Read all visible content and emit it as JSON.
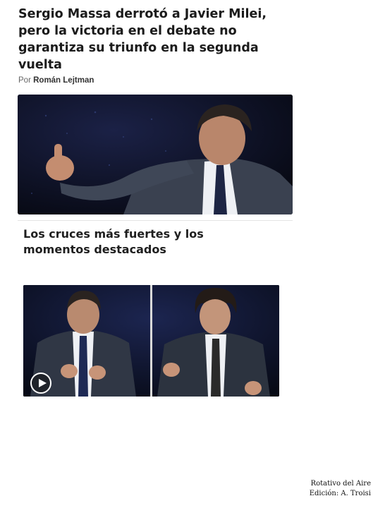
{
  "article": {
    "headline": "Sergio Massa derrotó a Javier Milei, pero la victoria en el debate no garantiza su triunfo en la segunda vuelta",
    "byline_prefix": "Por",
    "author": "Román Lejtman"
  },
  "related": {
    "heading": "Los cruces más fuertes y los momentos destacados"
  },
  "credit": {
    "line1": "Rotativo del Aire",
    "line2": "Edición: A. Troisi"
  },
  "icons": {
    "play": "play-icon"
  },
  "colors": {
    "background": "#ffffff",
    "headline": "#1b1b1b",
    "byline": "#666666",
    "photo_backdrop": "#0c0f1d"
  }
}
